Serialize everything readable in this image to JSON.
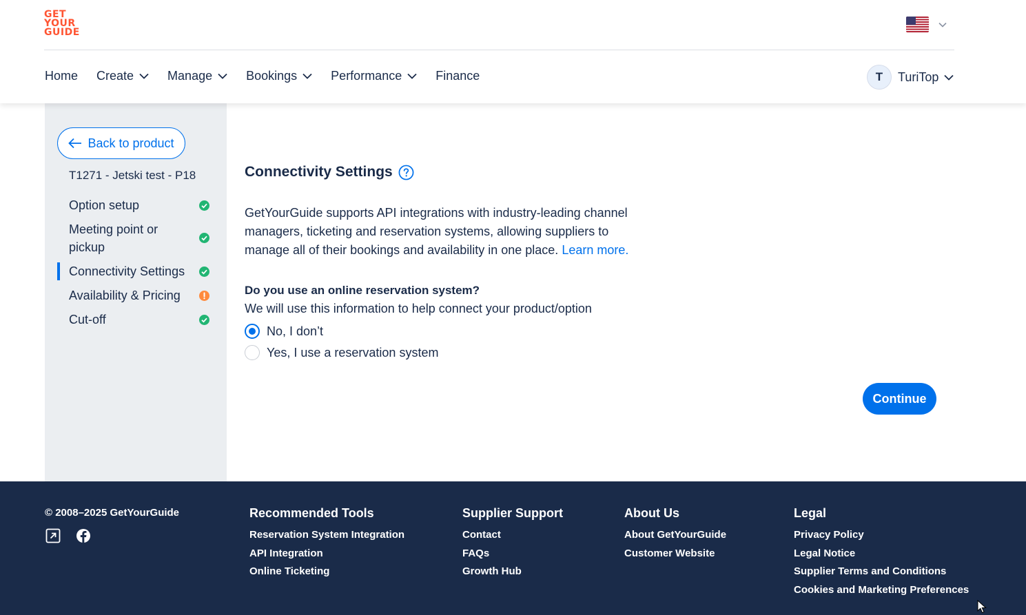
{
  "logo": {
    "lines": [
      "GET",
      "YOUR",
      "GUIDE"
    ]
  },
  "header": {
    "nav": [
      {
        "label": "Home",
        "has_dropdown": false
      },
      {
        "label": "Create",
        "has_dropdown": true
      },
      {
        "label": "Manage",
        "has_dropdown": true
      },
      {
        "label": "Bookings",
        "has_dropdown": true
      },
      {
        "label": "Performance",
        "has_dropdown": true
      },
      {
        "label": "Finance",
        "has_dropdown": false
      }
    ],
    "user": {
      "initial": "T",
      "name": "TuriTop"
    },
    "language_icon": "us-flag-icon"
  },
  "sidebar": {
    "back_label": "Back to product",
    "product_title": "T1271 - Jetski test - P18",
    "steps": [
      {
        "label": "Option setup",
        "status": "complete"
      },
      {
        "label": "Meeting point or pickup",
        "status": "complete"
      },
      {
        "label": "Connectivity Settings",
        "status": "complete",
        "active": true
      },
      {
        "label": "Availability & Pricing",
        "status": "warning"
      },
      {
        "label": "Cut-off",
        "status": "complete"
      }
    ]
  },
  "main": {
    "title": "Connectivity Settings",
    "description": "GetYourGuide supports API integrations with industry-leading channel managers, ticketing and reservation systems, allowing suppliers to manage all of their bookings and availability in one place.",
    "learn_more": "Learn more.",
    "question": "Do you use an online reservation system?",
    "hint": "We will use this information to help connect your product/option",
    "options": [
      {
        "label": "No, I don’t",
        "checked": true
      },
      {
        "label": "Yes, I use a reservation system",
        "checked": false
      }
    ],
    "continue_label": "Continue"
  },
  "footer": {
    "copyright": "© 2008–2025 GetYourGuide",
    "columns": [
      {
        "title": "Recommended Tools",
        "links": [
          "Reservation System Integration",
          "API Integration",
          "Online Ticketing"
        ]
      },
      {
        "title": "Supplier Support",
        "links": [
          "Contact",
          "FAQs",
          "Growth Hub"
        ]
      },
      {
        "title": "About Us",
        "links": [
          "About GetYourGuide",
          "Customer Website"
        ]
      },
      {
        "title": "Legal",
        "links": [
          "Privacy Policy",
          "Legal Notice",
          "Supplier Terms and Conditions",
          "Cookies and Marketing Preferences"
        ]
      }
    ]
  },
  "colors": {
    "brand": "#ff5533",
    "primary": "#0071eb",
    "navy": "#1a2b49",
    "success": "#21b573",
    "warning": "#ff8a3d"
  }
}
